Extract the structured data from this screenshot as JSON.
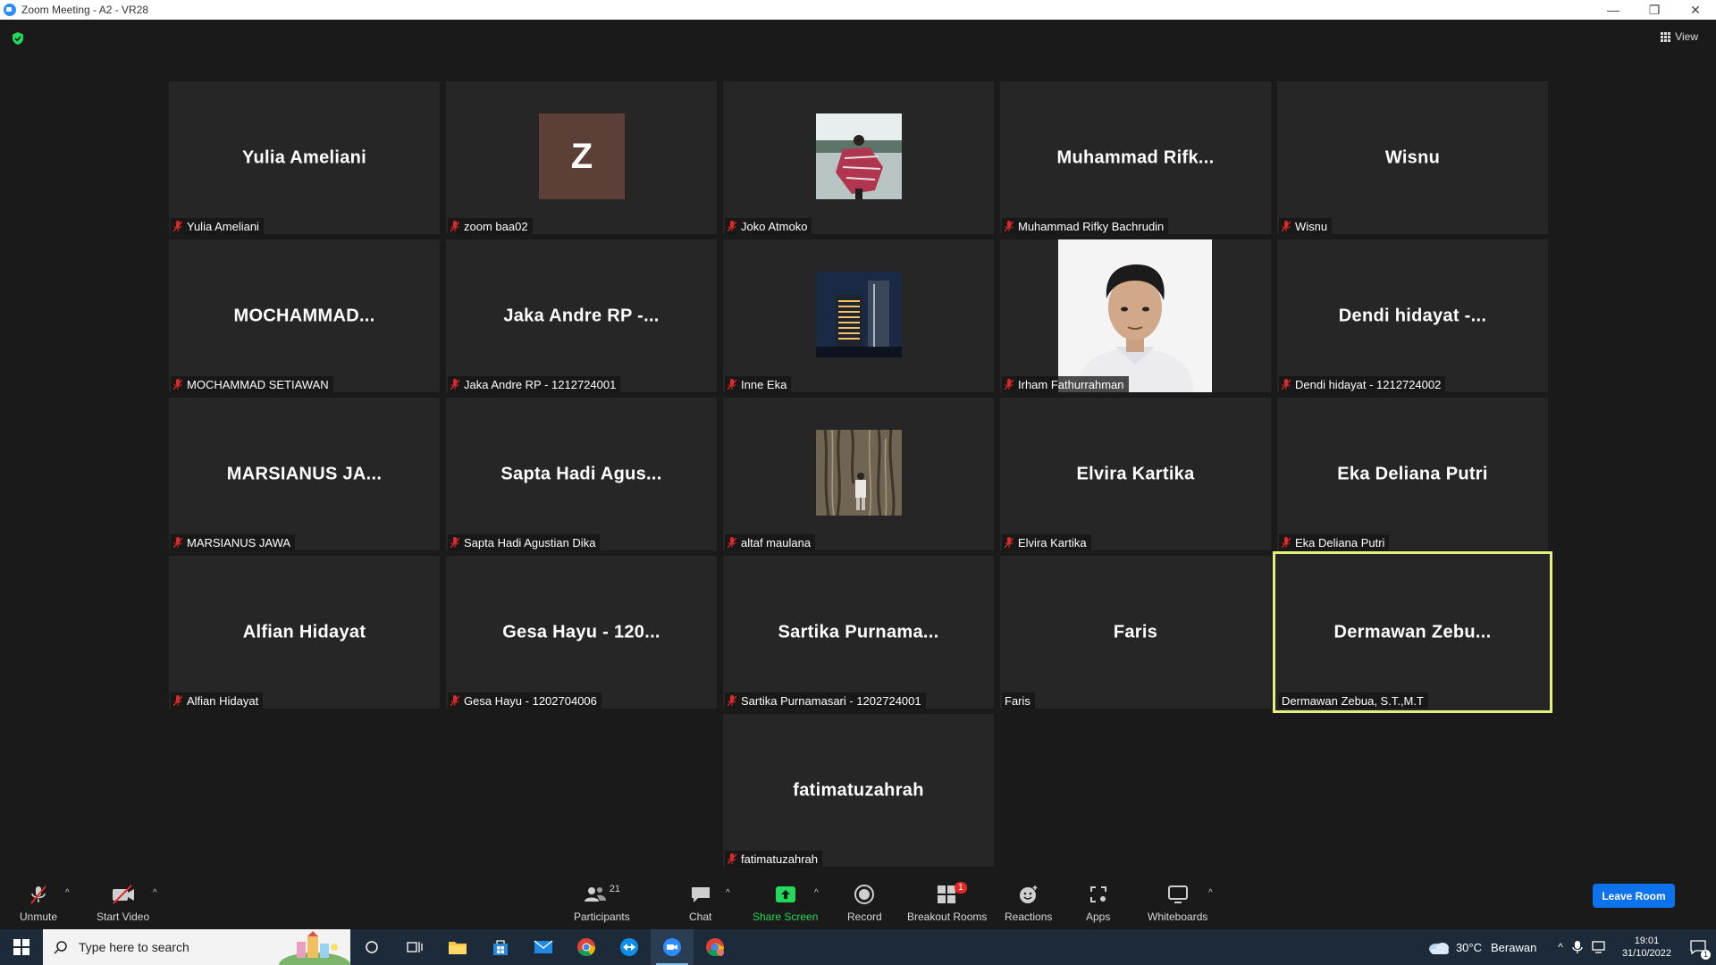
{
  "window": {
    "title": "Zoom Meeting - A2 - VR28",
    "minimize": "—",
    "restore": "❐",
    "close": "✕"
  },
  "top": {
    "view_label": "View"
  },
  "participants": [
    {
      "display": "Yulia Ameliani",
      "label": "Yulia Ameliani",
      "muted": true
    },
    {
      "display": "Z",
      "label": "zoom baa02",
      "muted": true,
      "avatar": "letter",
      "avatar_color": "#5c3f36"
    },
    {
      "display": "",
      "label": "Joko Atmoko",
      "muted": true,
      "avatar": "photo"
    },
    {
      "display": "Muhammad  Rifk...",
      "label": "Muhammad Rifky Bachrudin",
      "muted": true
    },
    {
      "display": "Wisnu",
      "label": "Wisnu",
      "muted": true
    },
    {
      "display": "MOCHAMMAD...",
      "label": "MOCHAMMAD SETIAWAN",
      "muted": true
    },
    {
      "display": "Jaka Andre RP -...",
      "label": "Jaka Andre RP - 1212724001",
      "muted": true
    },
    {
      "display": "",
      "label": "Inne Eka",
      "muted": true,
      "avatar": "photo"
    },
    {
      "display": "",
      "label": "Irham Fathurrahman",
      "muted": true,
      "avatar": "video"
    },
    {
      "display": "Dendi hidayat -...",
      "label": "Dendi hidayat - 1212724002",
      "muted": true
    },
    {
      "display": "MARSIANUS  JA...",
      "label": "MARSIANUS JAWA",
      "muted": true
    },
    {
      "display": "Sapta Hadi Agus...",
      "label": "Sapta Hadi Agustian Dika",
      "muted": true
    },
    {
      "display": "",
      "label": "altaf maulana",
      "muted": true,
      "avatar": "photo"
    },
    {
      "display": "Elvira Kartika",
      "label": "Elvira Kartika",
      "muted": true
    },
    {
      "display": "Eka Deliana Putri",
      "label": "Eka Deliana Putri",
      "muted": true
    },
    {
      "display": "Alfian Hidayat",
      "label": "Alfian Hidayat",
      "muted": true
    },
    {
      "display": "Gesa Hayu - 120...",
      "label": "Gesa Hayu - 1202704006",
      "muted": true
    },
    {
      "display": "Sartika  Purnama...",
      "label": "Sartika Purnamasari - 1202724001",
      "muted": true
    },
    {
      "display": "Faris",
      "label": "Faris",
      "muted": false
    },
    {
      "display": "Dermawan  Zebu...",
      "label": "Dermawan Zebua, S.T.,M.T",
      "muted": false,
      "active_speaker": true
    },
    {
      "display": "fatimatuzahrah",
      "label": "fatimatuzahrah",
      "muted": true
    }
  ],
  "toolbar": {
    "unmute": "Unmute",
    "start_video": "Start Video",
    "participants": "Participants",
    "participants_count": "21",
    "chat": "Chat",
    "share_screen": "Share Screen",
    "record": "Record",
    "breakout_rooms": "Breakout Rooms",
    "breakout_badge": "1",
    "reactions": "Reactions",
    "apps": "Apps",
    "whiteboards": "Whiteboards",
    "leave": "Leave Room",
    "caret": "^"
  },
  "taskbar": {
    "search_placeholder": "Type here to search",
    "weather_temp": "30°C",
    "weather_desc": "Berawan",
    "time": "19:01",
    "date": "31/10/2022",
    "notification_count": "1"
  },
  "colors": {
    "accent_blue": "#0e72ed",
    "share_green": "#23d959",
    "active_speaker": "#e6ef7a",
    "mic_muted_red": "#e02828"
  }
}
